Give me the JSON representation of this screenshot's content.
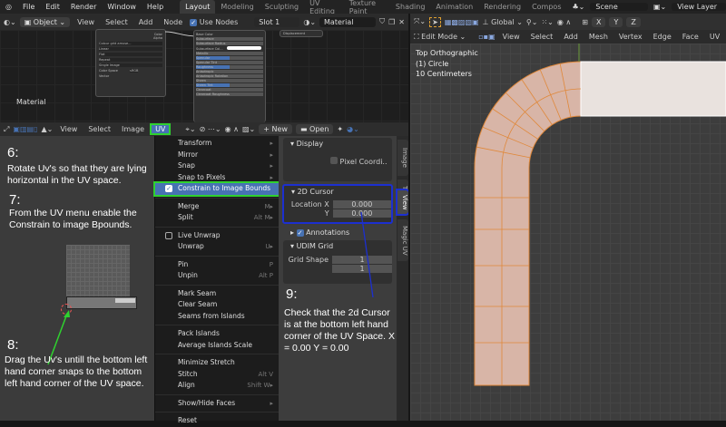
{
  "topbar": {
    "menus": [
      "File",
      "Edit",
      "Render",
      "Window",
      "Help"
    ],
    "workspaces": [
      "Layout",
      "Modeling",
      "Sculpting",
      "UV Editing",
      "Texture Paint",
      "Shading",
      "Animation",
      "Rendering",
      "Compos"
    ],
    "scene": "Scene",
    "view_layer": "View Layer"
  },
  "node_editor": {
    "mode": "Object",
    "menus": [
      "View",
      "Select",
      "Add",
      "Node"
    ],
    "use_nodes": "Use Nodes",
    "slot": "Slot 1",
    "material": "Material",
    "label": "Material",
    "image_node": {
      "image": "Colour grid amuse...",
      "interp": "Linear",
      "proj": "Flat",
      "ext": "Repeat",
      "source": "Single Image",
      "cs_label": "Color Space",
      "cs": "sRGB",
      "vector": "Vector",
      "color": "Color",
      "alpha": "Alpha"
    },
    "bsdf_inputs": [
      "Base Color",
      "Subsurface",
      "Subsurface Radius",
      "Subsurface Col...",
      "Metallic",
      "Specular",
      "Specular Tint",
      "Roughness",
      "Anisotropic",
      "Anisotropic Rotation",
      "Sheen",
      "Sheen Tint",
      "Clearcoat",
      "Clearcoat Roughness"
    ],
    "output": "Displacement"
  },
  "uv_editor": {
    "menus": [
      "View",
      "Select",
      "Image",
      "UV"
    ],
    "new": "New",
    "open": "Open"
  },
  "uv_menu": {
    "items": [
      {
        "label": "Transform",
        "sc": "▸"
      },
      {
        "label": "Mirror",
        "sc": "▸"
      },
      {
        "label": "Snap",
        "sc": "▸"
      },
      {
        "label": "Snap to Pixels",
        "sc": "▸"
      },
      {
        "label": "Constrain to Image Bounds",
        "sc": ""
      },
      "-",
      {
        "label": "Merge",
        "sc": "M▸"
      },
      {
        "label": "Split",
        "sc": "Alt M▸"
      },
      "-",
      {
        "label": "Live Unwrap",
        "sc": ""
      },
      {
        "label": "Unwrap",
        "sc": "U▸"
      },
      "-",
      {
        "label": "Pin",
        "sc": "P"
      },
      {
        "label": "Unpin",
        "sc": "Alt P"
      },
      "-",
      {
        "label": "Mark Seam",
        "sc": ""
      },
      {
        "label": "Clear Seam",
        "sc": ""
      },
      {
        "label": "Seams from Islands",
        "sc": ""
      },
      "-",
      {
        "label": "Pack Islands",
        "sc": ""
      },
      {
        "label": "Average Islands Scale",
        "sc": ""
      },
      "-",
      {
        "label": "Minimize Stretch",
        "sc": ""
      },
      {
        "label": "Stitch",
        "sc": "Alt V"
      },
      {
        "label": "Align",
        "sc": "Shift W▸"
      },
      "-",
      {
        "label": "Show/Hide Faces",
        "sc": "▸"
      },
      "-",
      {
        "label": "Reset",
        "sc": ""
      }
    ]
  },
  "sidebar": {
    "display": "Display",
    "pixel_coords": "Pixel Coordi..",
    "cursor": "2D Cursor",
    "loc_x_label": "Location X",
    "loc_x": "0.000",
    "y_label": "Y",
    "loc_y": "0.000",
    "annotations": "Annotations",
    "udim": "UDIM Grid",
    "grid_shape": "Grid Shape",
    "grid_x": "1",
    "grid_y": "1",
    "tabs": [
      "Image",
      "Tool",
      "View",
      "Magic UV"
    ]
  },
  "notes": {
    "n6": "6:",
    "t6": "Rotate Uv's so that they are lying horizontal in the UV space.",
    "n7": "7:",
    "t7": "From the UV menu enable the Constrain to image Bpounds.",
    "n8": "8:",
    "t8": "Drag the Uv's untill the bottom left hand corner snaps to the bottom left hand corner of the UV space.",
    "n9": "9:",
    "t9": "Check that the 2d Cursor is at the bottom left hand corner of the UV Space. X = 0.00  Y = 0.00"
  },
  "viewport": {
    "transform": "Global",
    "mode": "Edit Mode",
    "menus": [
      "View",
      "Select",
      "Add",
      "Mesh",
      "Vertex",
      "Edge",
      "Face",
      "UV"
    ],
    "axes": [
      "X",
      "Y",
      "Z"
    ],
    "info": [
      "Top Orthographic",
      "(1) Circle",
      "10 Centimeters"
    ]
  },
  "colors": {
    "accent": "#4772b3",
    "highlight_green": "#2fd12f",
    "annot_blue": "#1c2fd0",
    "mesh": "#d8b5a7",
    "edge": "#e0883a"
  }
}
